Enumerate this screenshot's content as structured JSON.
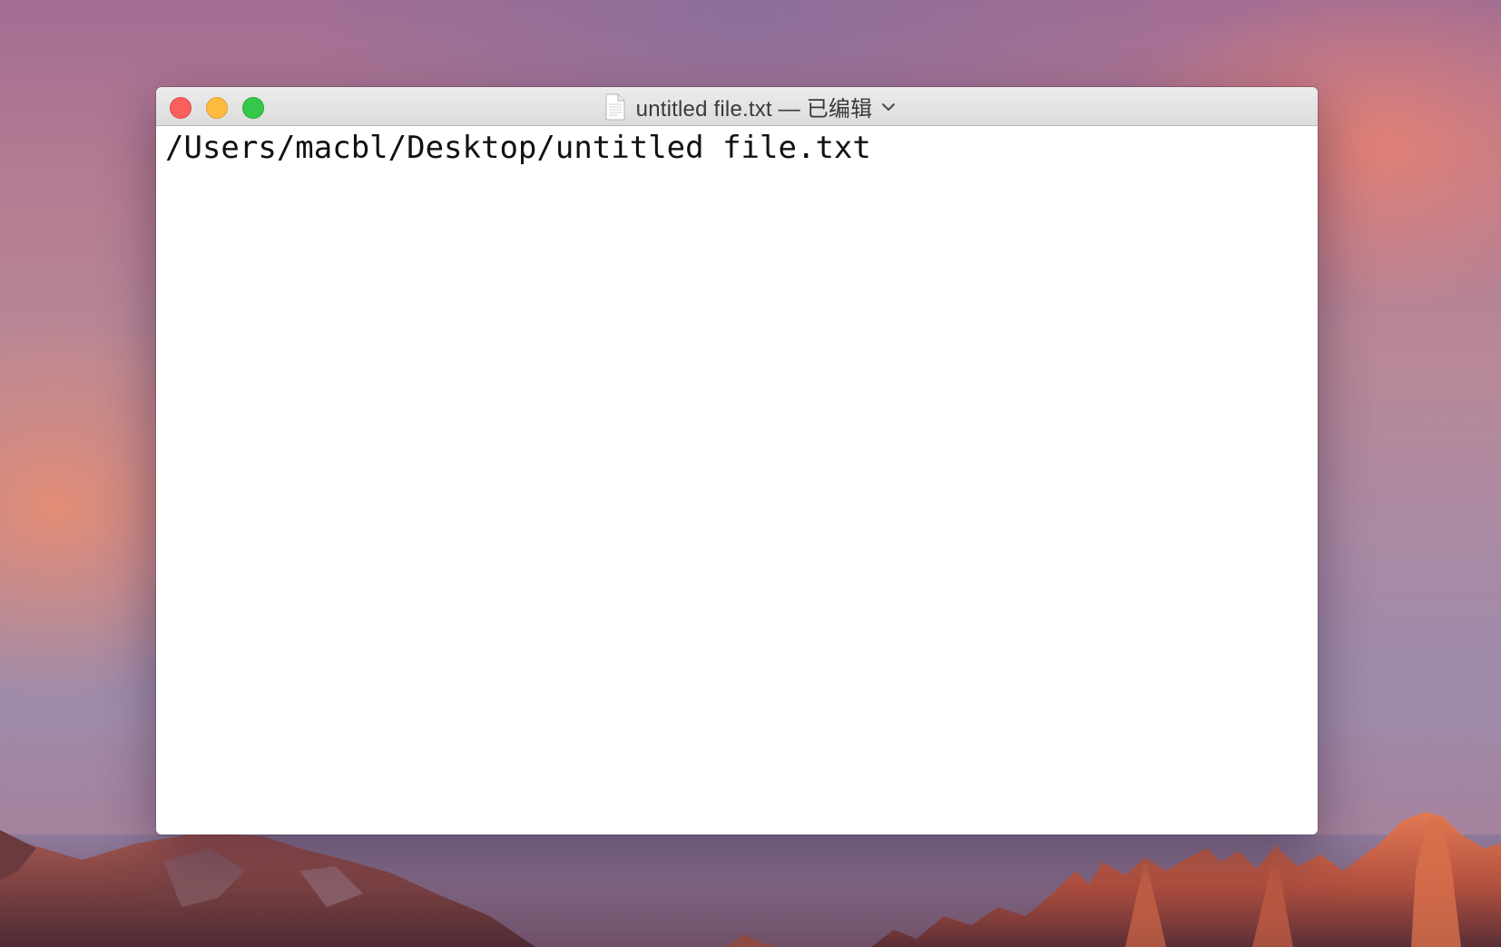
{
  "window": {
    "title": "untitled file.txt — 已编辑",
    "document_icon": "document-icon",
    "title_menu_icon": "chevron-down-icon",
    "controls": {
      "close_icon": "close-button",
      "minimize_icon": "minimize-button",
      "zoom_icon": "zoom-button",
      "close_color": "#fc605c",
      "minimize_color": "#fdbc40",
      "zoom_color": "#34c84a"
    }
  },
  "editor": {
    "text": "/Users/macbl/Desktop/untitled file.txt"
  }
}
